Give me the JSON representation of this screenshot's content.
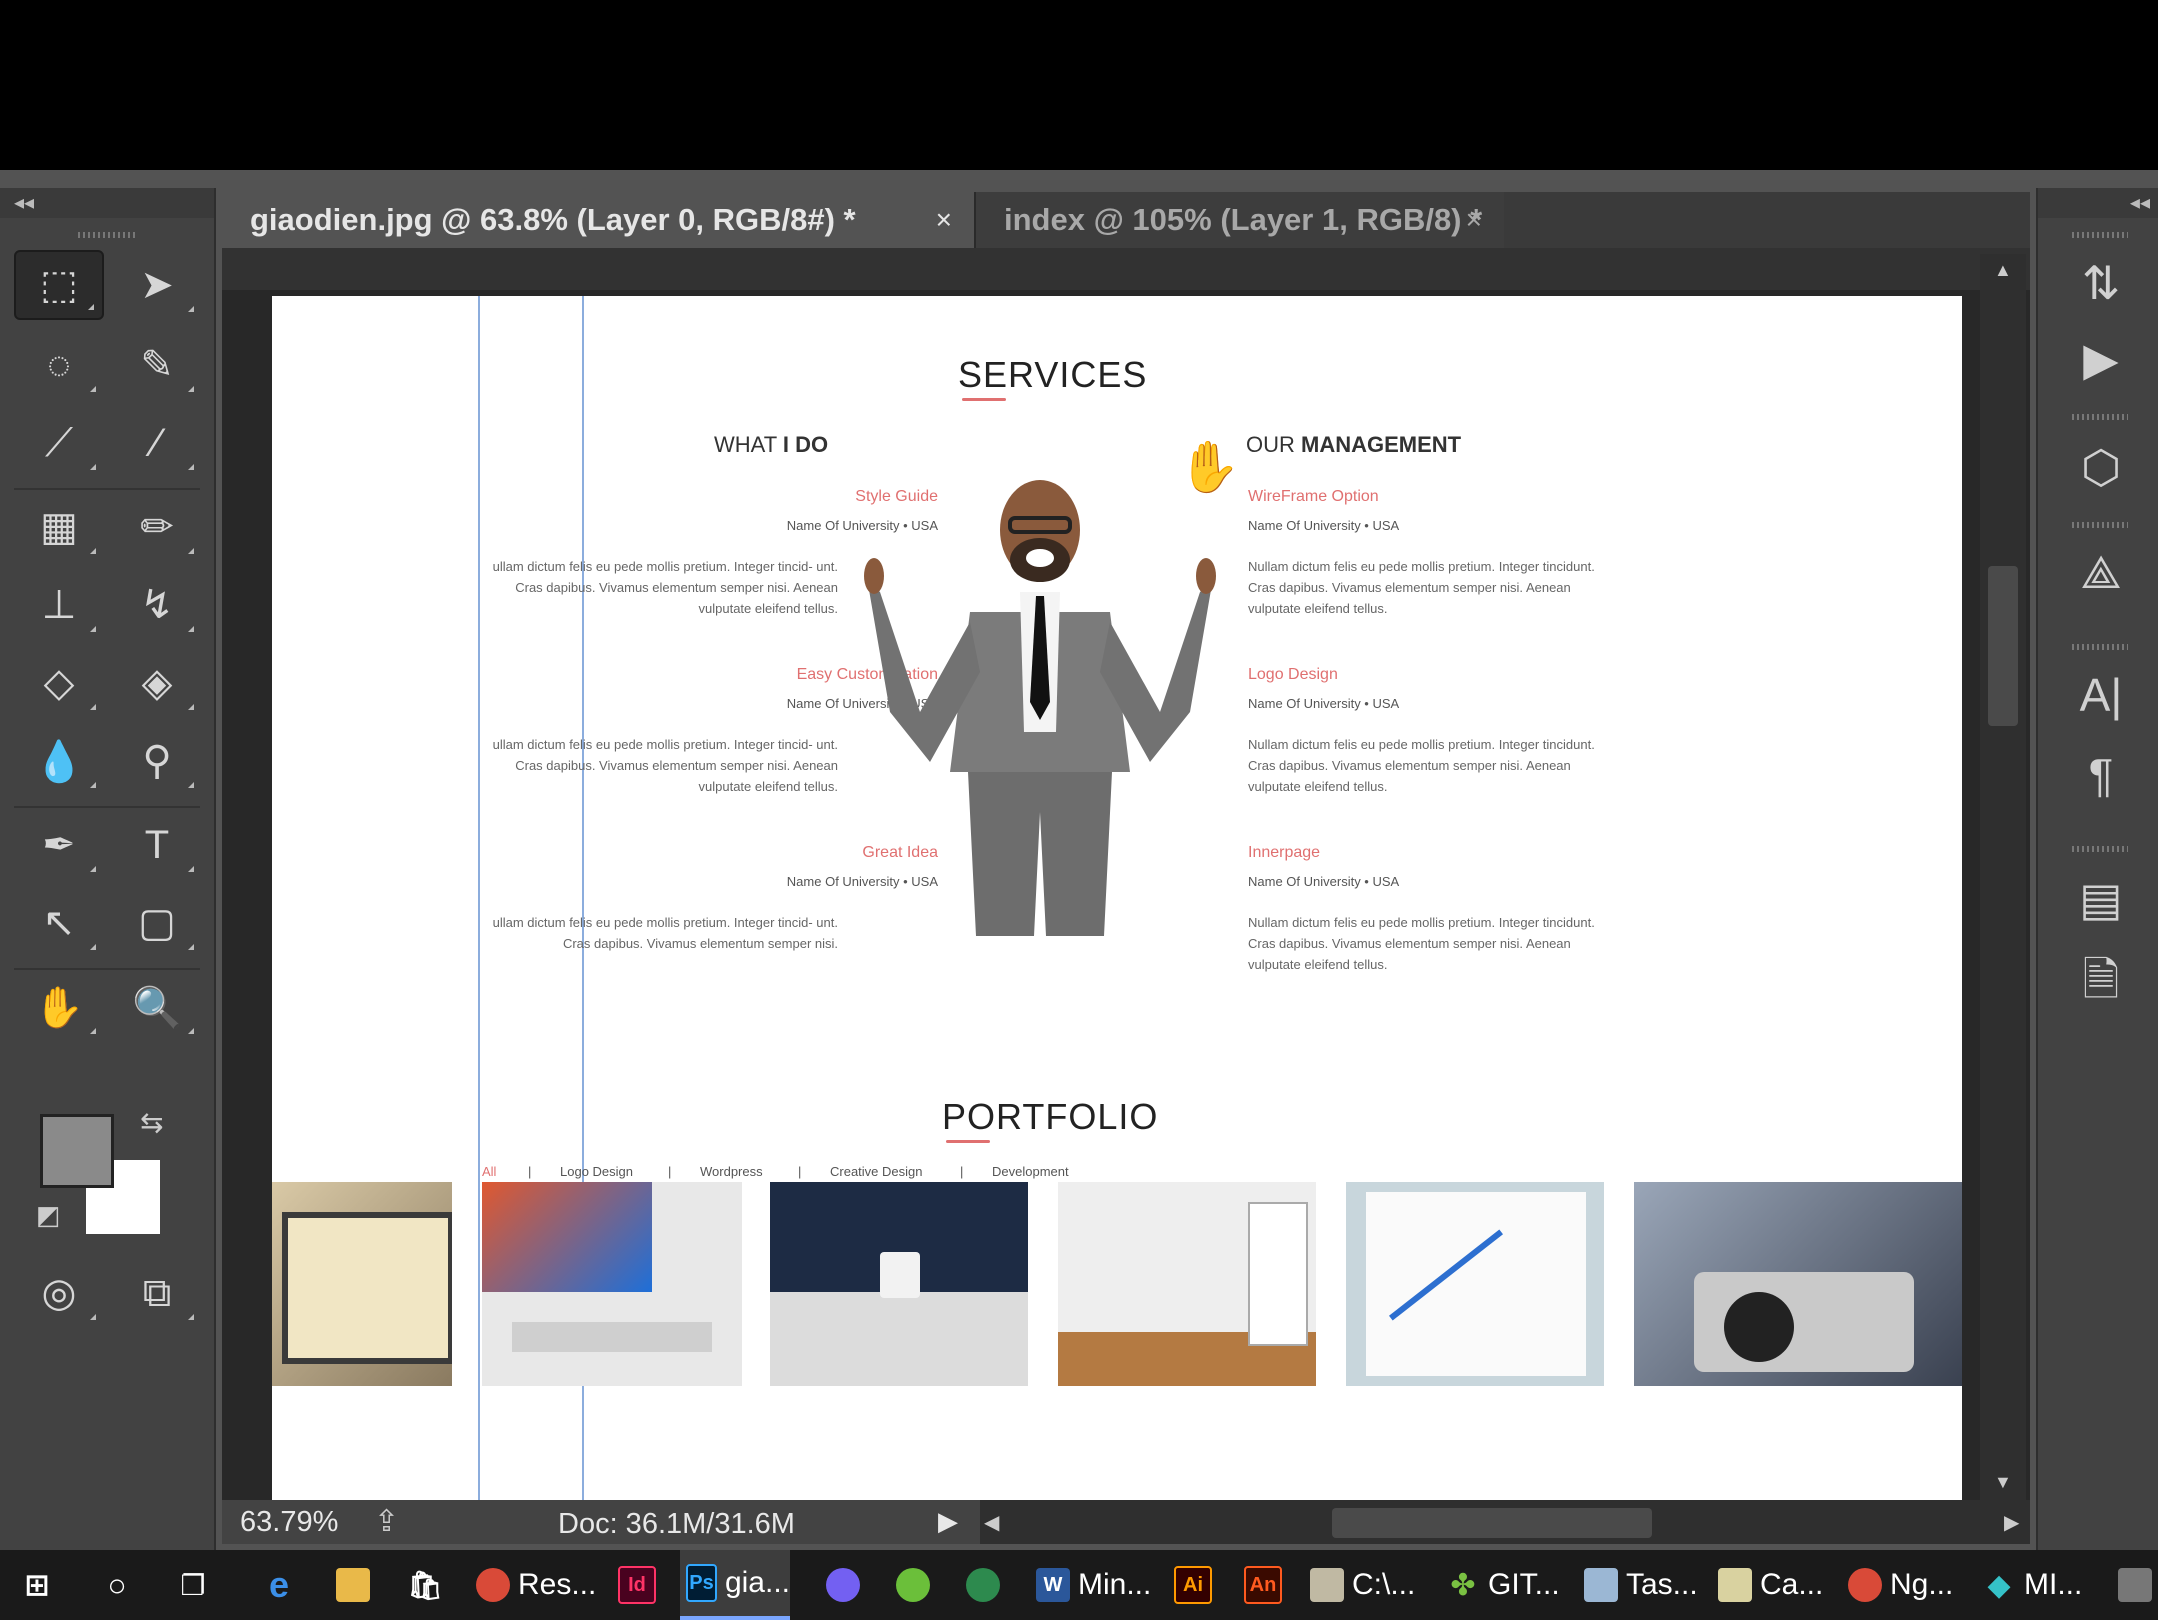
{
  "tabs": [
    {
      "label": "giaodien.jpg @ 63.8% (Layer 0, RGB/8#) *",
      "close": "×"
    },
    {
      "label": "index @ 105% (Layer 1, RGB/8) *",
      "close": "×"
    }
  ],
  "panel_collapse": "◂◂",
  "status": {
    "zoom": "63.79%",
    "doc": "Doc: 36.1M/31.6M"
  },
  "page": {
    "services_title": "SERVICES",
    "what_i_do": {
      "pre": "WHAT ",
      "bold": "I DO"
    },
    "our_management": {
      "pre": "OUR ",
      "bold": "MANAGEMENT"
    },
    "left_services": [
      {
        "title": "Style Guide",
        "sub": "Name Of University • USA",
        "body": "ullam dictum felis eu pede mollis pretium. Integer tincid- unt. Cras dapibus. Vivamus elementum semper nisi. Aenean vulputate eleifend tellus."
      },
      {
        "title": "Easy Customization",
        "sub": "Name Of University • USA",
        "body": "ullam dictum felis eu pede mollis pretium. Integer tincid- unt. Cras dapibus. Vivamus elementum semper nisi. Aenean vulputate eleifend tellus."
      },
      {
        "title": "Great Idea",
        "sub": "Name Of University • USA",
        "body": "ullam dictum felis eu pede mollis pretium. Integer tincid- unt. Cras dapibus. Vivamus elementum semper nisi."
      }
    ],
    "right_services": [
      {
        "title": "WireFrame Option",
        "sub": "Name Of University • USA",
        "body": "Nullam dictum felis eu pede mollis pretium. Integer tincidunt. Cras dapibus. Vivamus elementum semper nisi. Aenean vulputate eleifend tellus."
      },
      {
        "title": "Logo Design",
        "sub": "Name Of University • USA",
        "body": "Nullam dictum felis eu pede mollis pretium. Integer tincidunt. Cras dapibus. Vivamus elementum semper nisi. Aenean vulputate eleifend tellus."
      },
      {
        "title": "Innerpage",
        "sub": "Name Of University • USA",
        "body": "Nullam dictum felis eu pede mollis pretium. Integer tincidunt. Cras dapibus. Vivamus elementum semper nisi. Aenean vulputate eleifend tellus."
      }
    ],
    "portfolio_title": "PORTFOLIO",
    "filters": [
      "All",
      "|",
      "Logo Design",
      "|",
      "Wordpress",
      "|",
      "Creative Design",
      "|",
      "Development"
    ]
  },
  "taskbar": [
    {
      "label": "",
      "icon": "windows-start-icon"
    },
    {
      "label": "",
      "icon": "cortana-icon"
    },
    {
      "label": "",
      "icon": "task-view-icon"
    },
    {
      "label": "",
      "icon": "edge-icon"
    },
    {
      "label": "",
      "icon": "file-explorer-icon"
    },
    {
      "label": "",
      "icon": "store-icon"
    },
    {
      "label": "Res...",
      "icon": "chrome-icon"
    },
    {
      "label": "",
      "icon": "indesign-icon",
      "text": "Id"
    },
    {
      "label": "gia...",
      "icon": "photoshop-icon",
      "text": "Ps"
    },
    {
      "label": "",
      "icon": "viber-icon"
    },
    {
      "label": "",
      "icon": "app-green-icon"
    },
    {
      "label": "",
      "icon": "globe-icon"
    },
    {
      "label": "Min...",
      "icon": "word-icon",
      "text": "W"
    },
    {
      "label": "",
      "icon": "illustrator-icon",
      "text": "Ai"
    },
    {
      "label": "",
      "icon": "animate-icon",
      "text": "An"
    },
    {
      "label": "C:\\...",
      "icon": "terminal-icon"
    },
    {
      "label": "GIT...",
      "icon": "clover-icon"
    },
    {
      "label": "Tas...",
      "icon": "task-icon"
    },
    {
      "label": "Ca...",
      "icon": "calc-icon"
    },
    {
      "label": "Ng...",
      "icon": "chrome-icon"
    },
    {
      "label": "MI...",
      "icon": "gitkraken-icon"
    }
  ],
  "colors": {
    "accent": "#e07070",
    "ps_bg": "#535353",
    "panel": "#424242"
  }
}
